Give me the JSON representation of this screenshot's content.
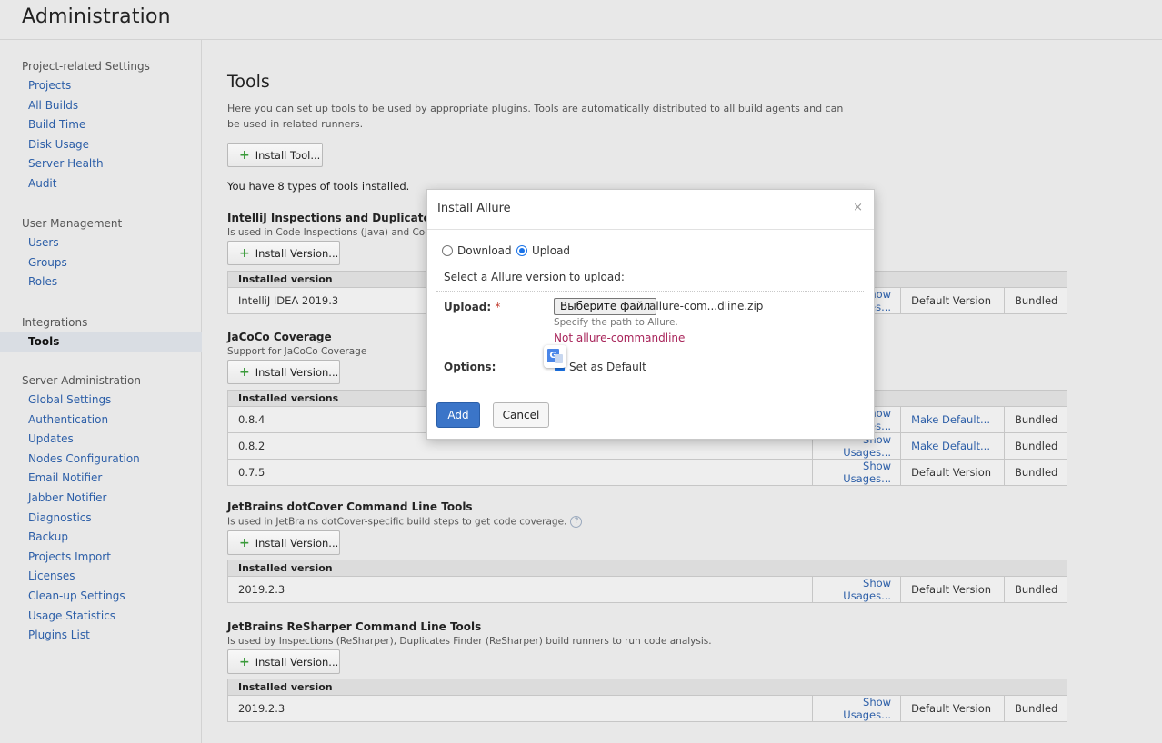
{
  "header": {
    "title": "Administration"
  },
  "sidebar": {
    "groups": [
      {
        "title": "Project-related Settings",
        "items": [
          "Projects",
          "All Builds",
          "Build Time",
          "Disk Usage",
          "Server Health",
          "Audit"
        ]
      },
      {
        "title": "User Management",
        "items": [
          "Users",
          "Groups",
          "Roles"
        ]
      },
      {
        "title": "Integrations",
        "items": [
          "Tools"
        ]
      },
      {
        "title": "Server Administration",
        "items": [
          "Global Settings",
          "Authentication",
          "Updates",
          "Nodes Configuration",
          "Email Notifier",
          "Jabber Notifier",
          "Diagnostics",
          "Backup",
          "Projects Import",
          "Licenses",
          "Clean-up Settings",
          "Usage Statistics",
          "Plugins List"
        ]
      }
    ],
    "active_item": "Tools"
  },
  "main": {
    "title": "Tools",
    "description_line1": "Here you can set up tools to be used by appropriate plugins. Tools are automatically distributed to all build agents and can",
    "description_line2": "be used in related runners.",
    "install_tool_label": "Install Tool...",
    "installed_count_text": "You have 8 types of tools installed.",
    "install_version_label": "Install Version...",
    "sections": [
      {
        "title": "IntelliJ Inspections and Duplicates Engine",
        "description": "Is used in Code Inspections (Java) and Code Duplicates (Java)",
        "header": "Installed version",
        "rows": [
          {
            "version": "IntelliJ IDEA 2019.3",
            "usage": "Show Usages...",
            "default": "Default Version",
            "bundled": "Bundled"
          }
        ]
      },
      {
        "title": "JaCoCo Coverage",
        "description": "Support for JaCoCo Coverage",
        "header": "Installed versions",
        "rows": [
          {
            "version": "0.8.4",
            "usage": "Show Usages...",
            "default": "Make Default...",
            "bundled": "Bundled"
          },
          {
            "version": "0.8.2",
            "usage": "Show Usages...",
            "default": "Make Default...",
            "bundled": "Bundled"
          },
          {
            "version": "0.7.5",
            "usage": "Show Usages...",
            "default": "Default Version",
            "bundled": "Bundled"
          }
        ]
      },
      {
        "title": "JetBrains dotCover Command Line Tools",
        "description": "Is used in JetBrains dotCover-specific build steps to get code coverage.",
        "help": "?",
        "header": "Installed version",
        "rows": [
          {
            "version": "2019.2.3",
            "usage": "Show Usages...",
            "default": "Default Version",
            "bundled": "Bundled"
          }
        ]
      },
      {
        "title": "JetBrains ReSharper Command Line Tools",
        "description": "Is used by Inspections (ReSharper), Duplicates Finder (ReSharper) build runners to run code analysis.",
        "header": "Installed version",
        "rows": [
          {
            "version": "2019.2.3",
            "usage": "Show Usages...",
            "default": "Default Version",
            "bundled": "Bundled"
          }
        ]
      }
    ]
  },
  "modal": {
    "title": "Install Allure",
    "close": "×",
    "option_download": "Download",
    "option_upload": "Upload",
    "selected_option": "Upload",
    "select_prompt": "Select a Allure version to upload:",
    "upload_label": "Upload:",
    "required_mark": "*",
    "file_button": "Выберите файл",
    "file_name": "allure-com...dline.zip",
    "path_hint": "Specify the path to Allure.",
    "error_text": "Not allure-commandline",
    "options_label": "Options:",
    "set_default_label": "Set as Default",
    "set_default_checked": true,
    "add_button": "Add",
    "cancel_button": "Cancel",
    "colors": {
      "primary": "#3b75c8",
      "error": "#a8245a",
      "required": "#c0392b"
    }
  }
}
